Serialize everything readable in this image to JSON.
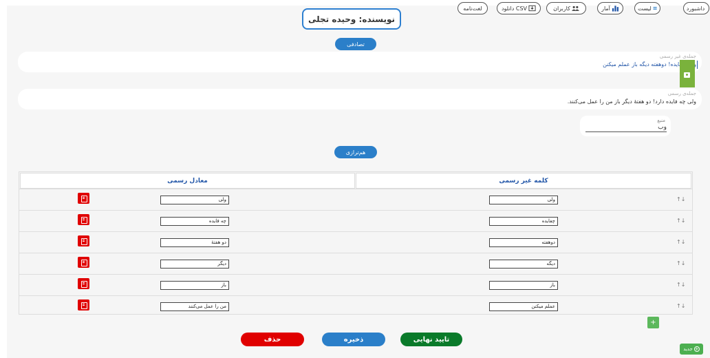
{
  "nav": {
    "dashboard": "داشبورد",
    "list": "لیست",
    "stats": "آمار",
    "users": "کاربران",
    "csv": "دانلود CSV",
    "dictionary": "لغت‌نامه"
  },
  "author": "نویسنده: وحیده تجلی",
  "random_label": "تصادفی",
  "informal": {
    "label": "جمله‌ی غیر رسمی",
    "text": "ولی چفایده! دوهفته دیگه باز عملم میکنن"
  },
  "formal": {
    "label": "جمله‌ی رسمی",
    "text": "ولی چه فایده دارد! دو هفتهٔ دیگر باز من را عمل می‌کنند."
  },
  "source": {
    "label": "منبع",
    "value": "وب"
  },
  "align_label": "هم‌ترازی",
  "table": {
    "headers": {
      "informal": "کلمه غیر رسمی",
      "formal": "معادل رسمی"
    },
    "rows": [
      {
        "informal": "ولی",
        "formal": "ولی"
      },
      {
        "informal": "چفایده",
        "formal": "چه فایده"
      },
      {
        "informal": "دوهفته",
        "formal": "دو هفتهٔ"
      },
      {
        "informal": "دیگه",
        "formal": "دیگر"
      },
      {
        "informal": "باز",
        "formal": "باز"
      },
      {
        "informal": "عملم میکنن",
        "formal": "من را عمل می‌کنند"
      }
    ],
    "sort_glyph": "↑↓"
  },
  "actions": {
    "confirm": "تایید نهایی",
    "save": "ذخیره",
    "delete": "حذف",
    "new": "جدید",
    "plus": "+"
  },
  "colors": {
    "blue": "#2b7fc9",
    "green_dark": "#0a7a2a",
    "red": "#e00000",
    "green_light": "#5cb85c"
  }
}
